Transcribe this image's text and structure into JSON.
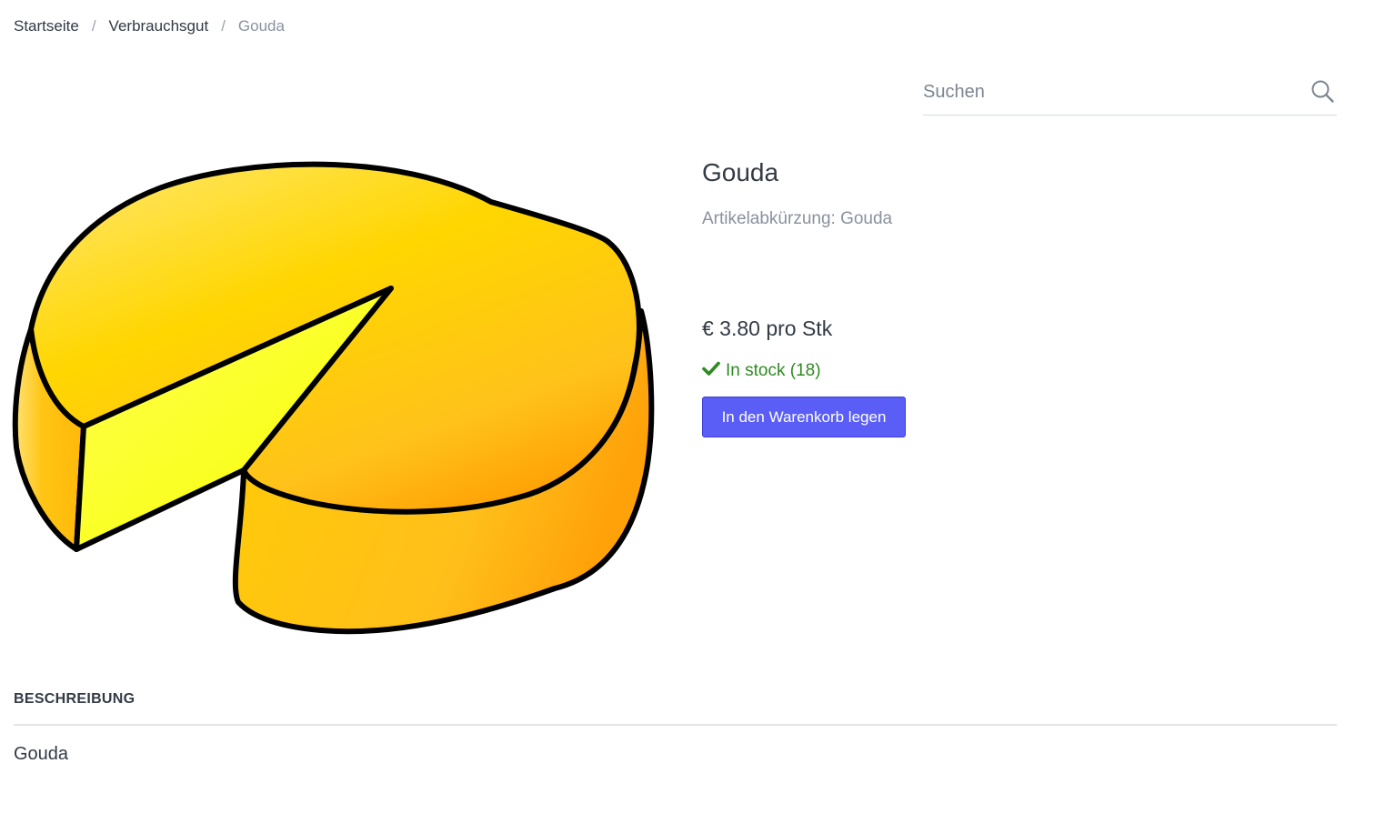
{
  "breadcrumb": {
    "home": "Startseite",
    "category": "Verbrauchsgut",
    "current": "Gouda",
    "separator": "/"
  },
  "search": {
    "placeholder": "Suchen",
    "icon": "search-icon"
  },
  "product": {
    "image_subject": "cheese-wheel-image",
    "title": "Gouda",
    "abbreviation": "Artikelabkürzung: Gouda",
    "price": "€ 3.80 pro Stk",
    "stock": "In stock (18)",
    "stock_icon": "checkmark-icon",
    "add_to_cart": "In den Warenkorb legen"
  },
  "description": {
    "heading": "BESCHREIBUNG",
    "text": "Gouda"
  },
  "colors": {
    "primary_button": "#5a5ef7",
    "in_stock": "#2f8a22",
    "muted_text": "#8a919e"
  }
}
